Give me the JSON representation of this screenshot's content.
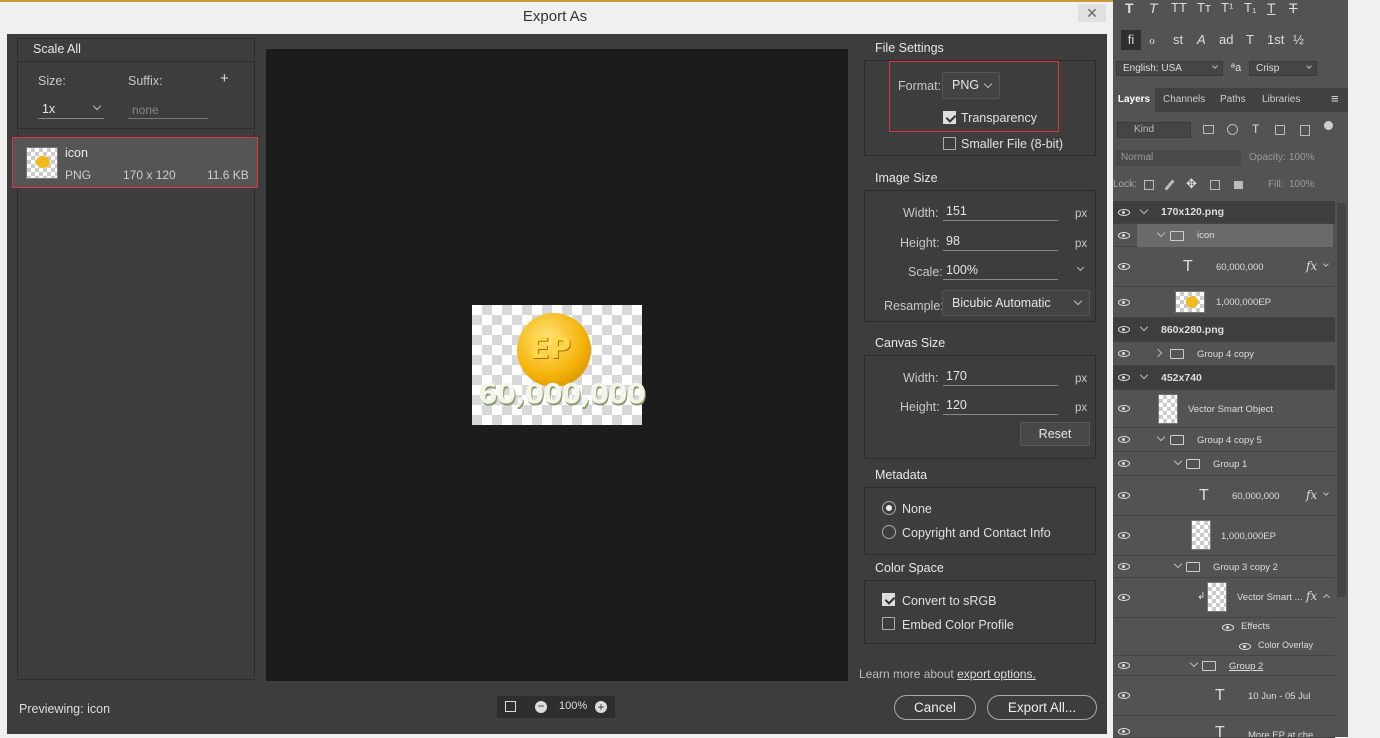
{
  "dialog": {
    "title": "Export As",
    "close_glyph": "✕"
  },
  "scale": {
    "header": "Scale All",
    "size_label": "Size:",
    "suffix_label": "Suffix:",
    "add_glyph": "+",
    "size_value": "1x",
    "suffix_placeholder": "none"
  },
  "asset": {
    "name": "icon",
    "format": "PNG",
    "dims": "170 x 120",
    "filesize": "11.6 KB"
  },
  "previewing": "Previewing: icon",
  "preview": {
    "coin_text": "EP",
    "amount_text": "60,000,000"
  },
  "zoom": {
    "level": "100%"
  },
  "file_settings": {
    "header": "File Settings",
    "format_label": "Format:",
    "format_value": "PNG",
    "transparency_label": "Transparency",
    "transparency_checked": true,
    "smaller_label": "Smaller File (8-bit)",
    "smaller_checked": false
  },
  "image_size": {
    "header": "Image Size",
    "width_label": "Width:",
    "width_value": "151",
    "width_unit": "px",
    "height_label": "Height:",
    "height_value": "98",
    "height_unit": "px",
    "scale_label": "Scale:",
    "scale_value": "100%",
    "resample_label": "Resample:",
    "resample_value": "Bicubic Automatic"
  },
  "canvas_size": {
    "header": "Canvas Size",
    "width_label": "Width:",
    "width_value": "170",
    "width_unit": "px",
    "height_label": "Height:",
    "height_value": "120",
    "height_unit": "px",
    "reset_label": "Reset"
  },
  "metadata": {
    "header": "Metadata",
    "none_label": "None",
    "copyright_label": "Copyright and Contact Info",
    "selected": "None"
  },
  "color_space": {
    "header": "Color Space",
    "convert_label": "Convert to sRGB",
    "convert_checked": true,
    "embed_label": "Embed Color Profile",
    "embed_checked": false
  },
  "learn": {
    "prefix": "Learn more about ",
    "link": "export options."
  },
  "buttons": {
    "cancel": "Cancel",
    "export_all": "Export All..."
  },
  "photoshop": {
    "type_tools": [
      "T",
      "T",
      "TT",
      "Tт",
      "T¹",
      "T₁",
      "T",
      "T"
    ],
    "type_tools2": [
      "fi",
      "ℴ",
      "st",
      "A",
      "ad",
      "T",
      "1st",
      "½"
    ],
    "language": "English: USA",
    "aa_glyph": "ªa",
    "antialias": "Crisp",
    "tabs": [
      "Layers",
      "Channels",
      "Paths",
      "Libraries"
    ],
    "menu_glyph": "≡",
    "filter_kind": "Kind",
    "blend_mode": "Normal",
    "opacity_label": "Opacity:",
    "opacity_value": "100%",
    "lock_label": "Lock:",
    "fill_label": "Fill:",
    "fill_value": "100%",
    "fx_glyph": "fx",
    "layers": [
      {
        "name": "170x120.png",
        "kind": "artboard"
      },
      {
        "name": "icon",
        "kind": "folder"
      },
      {
        "name": "60,000,000",
        "kind": "text"
      },
      {
        "name": "1,000,000EP",
        "kind": "smart"
      },
      {
        "name": "860x280.png",
        "kind": "artboard"
      },
      {
        "name": "Group 4 copy",
        "kind": "folder"
      },
      {
        "name": "452x740",
        "kind": "artboard"
      },
      {
        "name": "Vector Smart Object",
        "kind": "smart"
      },
      {
        "name": "Group 4 copy 5",
        "kind": "folder"
      },
      {
        "name": "Group 1",
        "kind": "folder"
      },
      {
        "name": "60,000,000",
        "kind": "text"
      },
      {
        "name": "1,000,000EP",
        "kind": "smart"
      },
      {
        "name": "Group 3 copy 2",
        "kind": "folder"
      },
      {
        "name": "Vector Smart ...",
        "kind": "smart"
      },
      {
        "name": "Effects",
        "kind": "effects"
      },
      {
        "name": "Color Overlay",
        "kind": "effect"
      },
      {
        "name": "Group 2",
        "kind": "folder"
      },
      {
        "name": "10 Jun - 05 Jul",
        "kind": "text"
      },
      {
        "name": "More EP at che...",
        "kind": "text"
      }
    ]
  }
}
